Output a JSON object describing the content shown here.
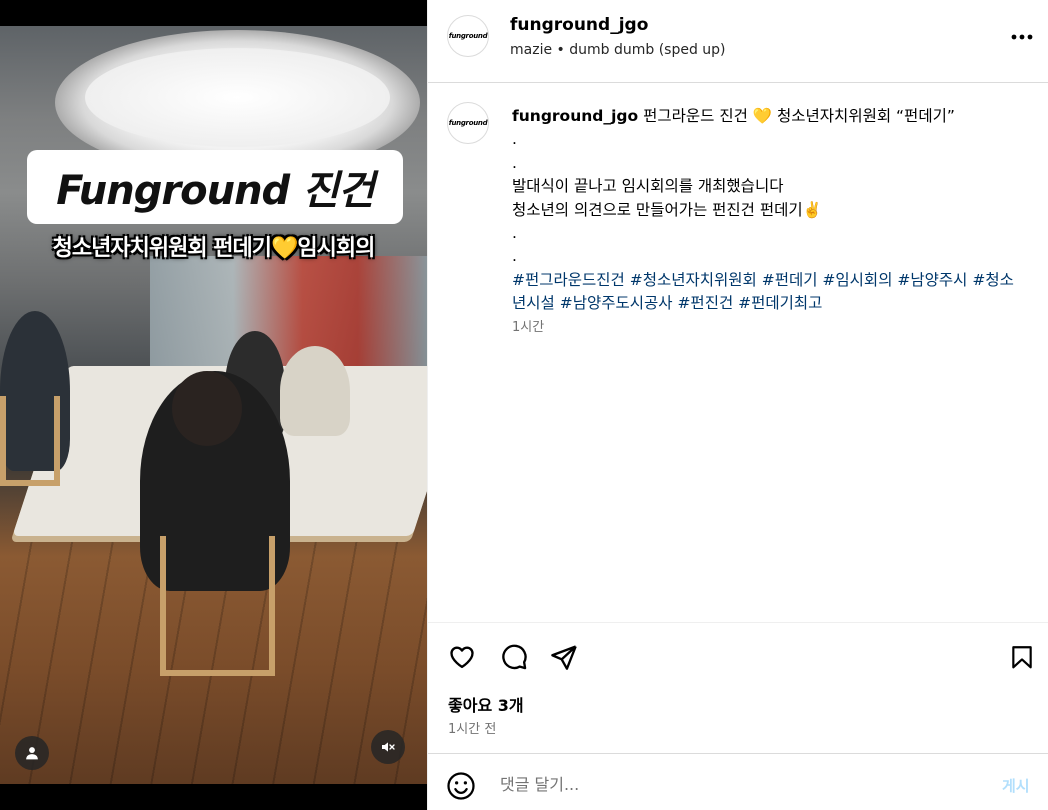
{
  "video": {
    "title_card": "Funground 진건",
    "subtitle": "청소년자치위원회 펀데기💛임시회의"
  },
  "header": {
    "avatar_text": "funground",
    "username": "funground_jgo",
    "audio": "mazie • dumb dumb (sped up)"
  },
  "caption": {
    "username": "funground_jgo",
    "text": " 펀그라운드 진건 💛 청소년자치위원회 “펀데기”\n.\n.\n발대식이 끝나고 임시회의를 개최했습니다\n청소년의 의견으로 만들어가는 펀진건 펀데기✌️\n.\n.\n",
    "hashtags": "#펀그라운드진건 #청소년자치위원회 #펀데기 #임시회의 #남양주시 #청소년시설 #남양주도시공사 #펀진건 #펀데기최고",
    "time": "1시간"
  },
  "actions": {
    "likes": "좋아요 3개",
    "time": "1시간 전"
  },
  "comment": {
    "placeholder": "댓글 달기...",
    "post_label": "게시"
  }
}
